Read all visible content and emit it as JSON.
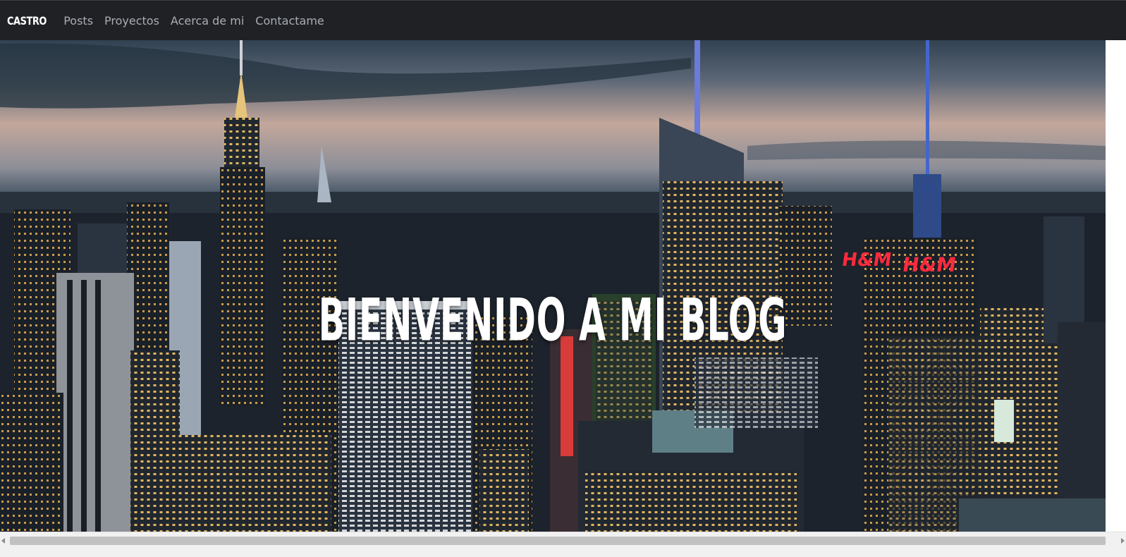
{
  "navbar": {
    "brand": "CASTRO",
    "links": [
      "Posts",
      "Proyectos",
      "Acerca de mi",
      "Contactame"
    ]
  },
  "hero": {
    "title": "BIENVENIDO A MI BLOG",
    "background": "night city skyline photo",
    "signs": [
      "H&M",
      "H&M"
    ]
  },
  "colors": {
    "navbar_bg": "#1f2125",
    "nav_link": "#a9adb3",
    "brand": "#ffffff",
    "hero_title": "#ffffff"
  }
}
